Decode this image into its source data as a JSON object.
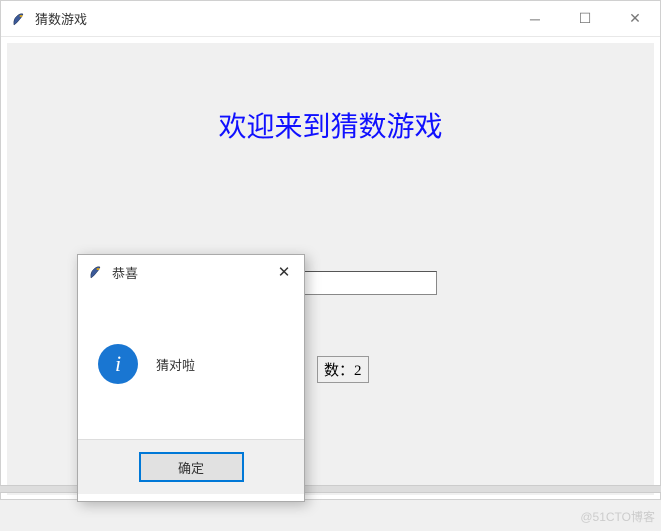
{
  "main_window": {
    "title": "猜数游戏",
    "heading": "欢迎来到猜数游戏",
    "input_value": "",
    "count_label": "数：2"
  },
  "dialog": {
    "title": "恭喜",
    "message": "猜对啦",
    "ok_label": "确定"
  },
  "watermark": "@51CTO博客"
}
